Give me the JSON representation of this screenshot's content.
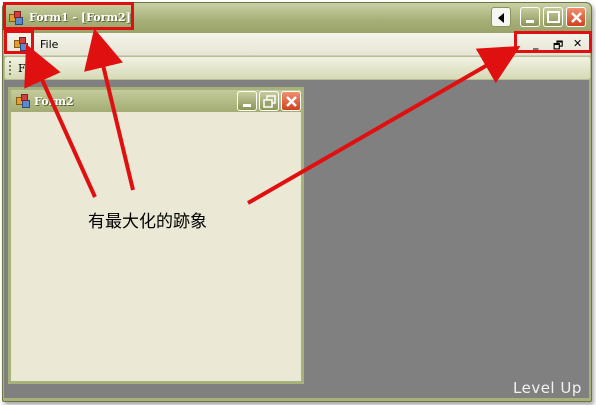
{
  "main_window": {
    "title": "Form1 - [Form2]",
    "menu": {
      "file_label": "File"
    },
    "mdi_controls": {
      "minimize": "_",
      "restore": "🗗",
      "close": "✕"
    },
    "toolbar": {
      "label": "Form"
    }
  },
  "child_window": {
    "title": "Form2"
  },
  "annotation": {
    "text": "有最大化的跡象",
    "color": "#e01010"
  },
  "watermark": "Level Up",
  "colors": {
    "title_bar": "#a5ae76",
    "mdi_background": "#808080",
    "child_body": "#ebe8d6"
  }
}
